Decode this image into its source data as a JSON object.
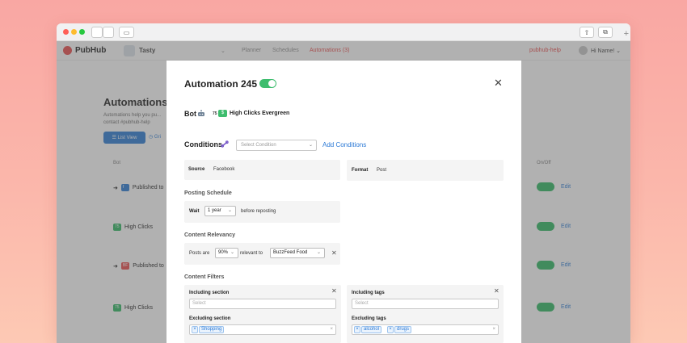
{
  "browser": {
    "share_glyph": "⇧",
    "tabs_glyph": "⧉",
    "sidebar_glyph": "▭",
    "plus_glyph": "+"
  },
  "app": {
    "logo": "PubHub",
    "brand": "Tasty",
    "brand_caret": "⌄",
    "nav": [
      "Planner",
      "Schedules",
      "Automations (3)"
    ],
    "help": "pubhub-help",
    "greeting": "Hi Name! ⌄",
    "page_title": "Automations",
    "page_desc": "Automations help you pu... contact #pubhub-help",
    "list_view": "☰ List View",
    "grid_view": "◷ Gri",
    "col_bot": "Bot",
    "col_onoff": "On/Off",
    "rows": [
      {
        "badge": "f",
        "label": "Published to",
        "arrow": "➜"
      },
      {
        "badge": "75",
        "label": "High Clicks",
        "arrow": ""
      },
      {
        "badge": "BF",
        "label": "Published to",
        "arrow": "➜"
      },
      {
        "badge": "75",
        "label": "High Clicks",
        "arrow": ""
      }
    ],
    "edit": "Edit"
  },
  "modal": {
    "title": "Automation 245",
    "enabled": true,
    "close": "✕",
    "bot_label": "Bot",
    "bot_icon": "robot-icon",
    "bot_score": "75",
    "bot_name": "High Clicks Evergreen",
    "conditions_label": "Conditions",
    "condition_placeholder": "Select Condition",
    "add_conditions": "Add Conditions",
    "source_label": "Source",
    "source_value": "Facebook",
    "format_label": "Format",
    "format_value": "Post",
    "posting_schedule": "Posting Schedule",
    "wait_label": "Wait",
    "wait_value": "1 year",
    "before_reposting": "before reposting",
    "content_relevancy": "Content Relevancy",
    "posts_are": "Posts are",
    "relevancy_value": "90%",
    "relevant_to": "relevant to",
    "relevant_target": "BuzzFeed Food",
    "content_filters": "Content Filters",
    "including_section": "Including section",
    "including_section_placeholder": "Select",
    "excluding_section": "Excluding section",
    "excluding_section_tags": [
      "Shopping"
    ],
    "including_tags": "Including tags",
    "including_tags_placeholder": "Select",
    "excluding_tags": "Excluding tags",
    "excluding_tags_values": [
      "alcohol",
      "drugs"
    ]
  }
}
